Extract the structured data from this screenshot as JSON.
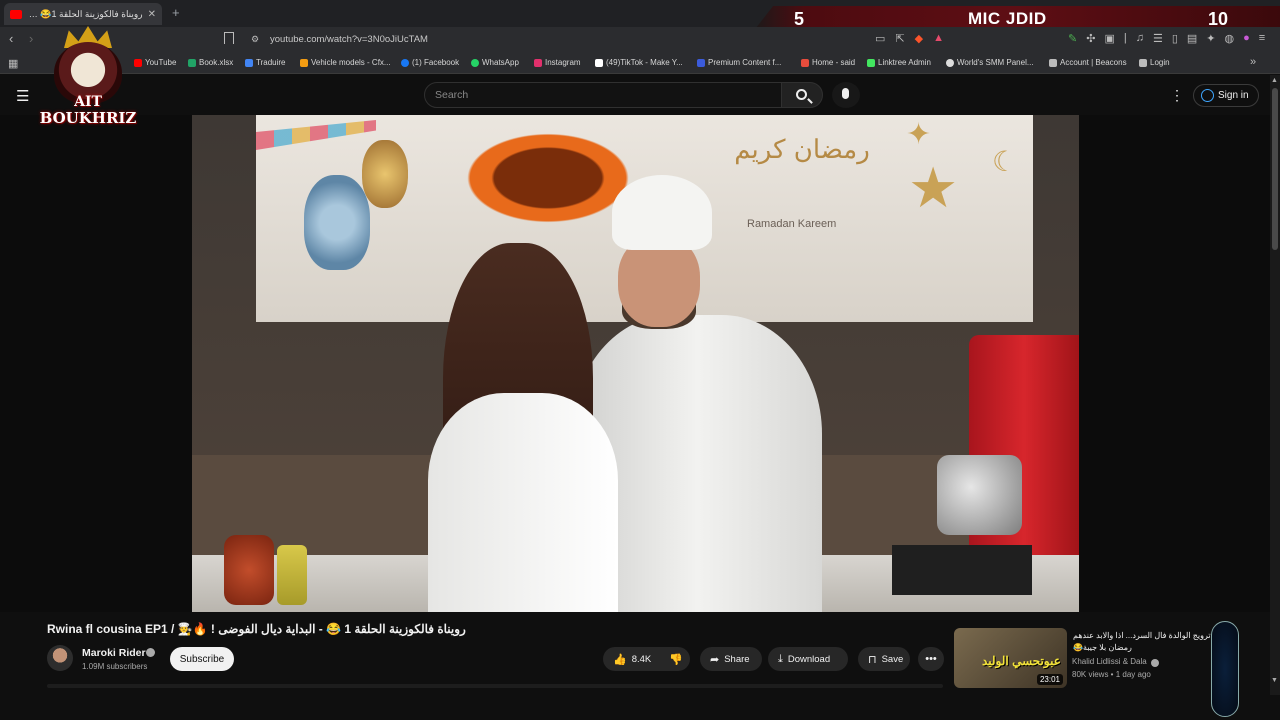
{
  "browser": {
    "tab_title": "رويناة فالكوزينة الحلقة 1😂 - البد...",
    "url": "youtube.com/watch?v=3N0oJiUcTAM",
    "bookmarks": [
      {
        "label": "YouTube",
        "color": "#ff0000"
      },
      {
        "label": "Book.xlsx",
        "color": "#21a366"
      },
      {
        "label": "Traduire",
        "color": "#4285f4"
      },
      {
        "label": "Vehicle models - Cfx...",
        "color": "#f39c12"
      },
      {
        "label": "(1) Facebook",
        "color": "#1877f2"
      },
      {
        "label": "WhatsApp",
        "color": "#25d366"
      },
      {
        "label": "Instagram",
        "color": "#e1306c"
      },
      {
        "label": "(49)TikTok - Make Y...",
        "color": "#ffffff"
      },
      {
        "label": "Premium Content f...",
        "color": "#3b5bdb"
      },
      {
        "label": "Home - said",
        "color": "#e74c3c"
      },
      {
        "label": "Linktree Admin",
        "color": "#43e660"
      },
      {
        "label": "World's SMM Panel...",
        "color": "#dddddd"
      },
      {
        "label": "Account | Beacons",
        "color": "#bbbbbb"
      },
      {
        "label": "Login",
        "color": "#bbbbbb"
      }
    ]
  },
  "scoreboard": {
    "left_score": "5",
    "title": "MIC JDID",
    "right_score": "10"
  },
  "channel_logo": {
    "line1": "AIT",
    "line2": "BOUKHRIZ"
  },
  "header": {
    "search_placeholder": "Search",
    "signin_label": "Sign in"
  },
  "video_frame": {
    "banner_arabic": "رمضان كريم",
    "banner_english": "Ramadan Kareem"
  },
  "video": {
    "title": "Rwina fl cousina EP1 / 🧑‍🍳🔥 ! رويناة فالكوزينة الحلقة 1 😂 - البداية ديال الفوضى",
    "channel": "Maroki Rider",
    "subscribers": "1.09M subscribers",
    "subscribe_label": "Subscribe",
    "likes": "8.4K",
    "share_label": "Share",
    "download_label": "Download",
    "save_label": "Save"
  },
  "recommended": {
    "title": "ترويج الوالدة فال السرد... اذا والابد عندهم رمضان بلا جيبة😂",
    "thumb_text": "عبوتحسي الوليد",
    "duration": "23:01",
    "channel": "Khalid Lidlissi & Dala",
    "meta": "80K views • 1 day ago"
  }
}
